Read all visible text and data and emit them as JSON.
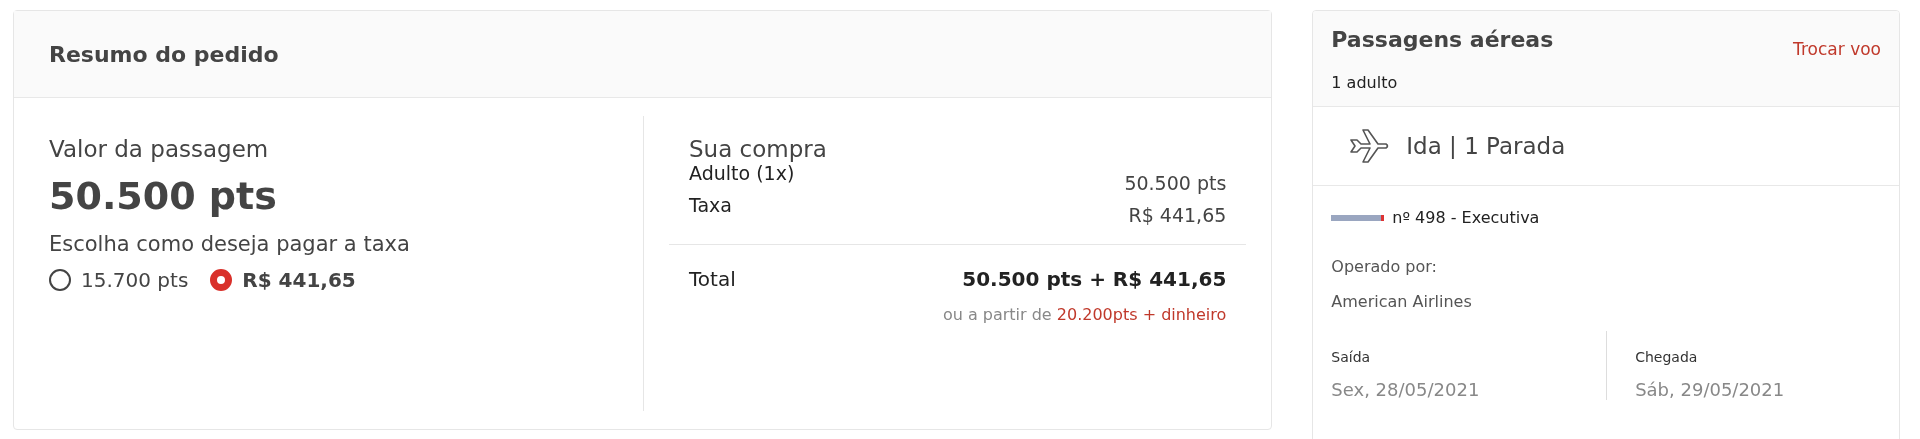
{
  "order_summary": {
    "title": "Resumo do pedido",
    "fare": {
      "label": "Valor da passagem",
      "amount": "50.500 pts",
      "fee_prompt": "Escolha como deseja pagar a taxa",
      "fee_options": [
        {
          "label": "15.700 pts",
          "selected": false
        },
        {
          "label": "R$ 441,65",
          "selected": true
        }
      ]
    },
    "purchase": {
      "title": "Sua compra",
      "lines": [
        {
          "label": "Adulto (1x)",
          "value": "50.500 pts"
        },
        {
          "label": "Taxa",
          "value": "R$ 441,65"
        }
      ],
      "total_label": "Total",
      "total_value": "50.500 pts + R$ 441,65",
      "alternative_prefix": "ou a partir de",
      "alternative_link": "20.200pts + dinheiro"
    }
  },
  "flights": {
    "title": "Passagens aéreas",
    "change_link": "Trocar voo",
    "passengers": "1 adulto",
    "leg": {
      "title": "Ida | 1 Parada",
      "flight": "nº 498 - Executiva",
      "operated_label": "Operado por:",
      "operator": "American Airlines",
      "times": [
        {
          "label": "Saída",
          "date": "Sex, 28/05/2021"
        },
        {
          "label": "Chegada",
          "date": "Sáb, 29/05/2021"
        }
      ]
    }
  }
}
